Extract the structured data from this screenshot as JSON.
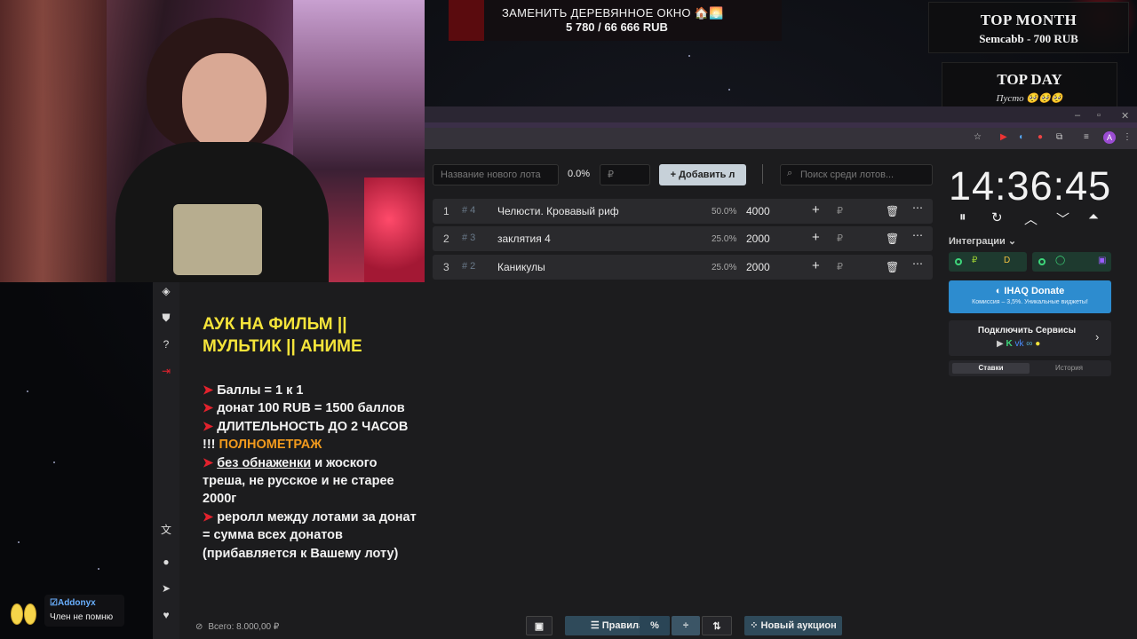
{
  "goal": {
    "title": "ЗАМЕНИТЬ ДЕРЕВЯННОЕ ОКНО 🏠🌅",
    "progress": "5 780 / 66 666 RUB"
  },
  "top_month": {
    "title": "TOP MONTH",
    "value": "Semcabb - 700 RUB"
  },
  "top_day": {
    "title": "TOP DAY",
    "value": "Пусто 🥺🥺🥺"
  },
  "browser": {
    "profile_initial": "A"
  },
  "auction": {
    "new_lot_placeholder": "Название нового лота",
    "percent": "0.0%",
    "amount_placeholder": "₽",
    "add_button": "Добавить л",
    "search_placeholder": "Поиск среди лотов...",
    "lots": [
      {
        "index": "1",
        "tag": "# 4",
        "name": "Челюсти. Кровавый риф",
        "percent": "50.0%",
        "amount": "4000",
        "currency": "₽"
      },
      {
        "index": "2",
        "tag": "# 3",
        "name": "заклятия 4",
        "percent": "25.0%",
        "amount": "2000",
        "currency": "₽"
      },
      {
        "index": "3",
        "tag": "# 2",
        "name": "Каникулы",
        "percent": "25.0%",
        "amount": "2000",
        "currency": "₽"
      }
    ]
  },
  "timer": {
    "time": "14:36:45",
    "integrations_label": "Интеграции",
    "donate_title": "IHAQ Donate",
    "donate_subtitle": "Комиссия – 3,5%. Уникальные виджеты!",
    "services_title": "Подключить Сервисы",
    "tab_bets": "Ставки",
    "tab_history": "История"
  },
  "rules": {
    "title": "АУК НА ФИЛЬМ || МУЛЬТИК || АНИМЕ",
    "line1": "Баллы = 1 к 1",
    "line2": "донат 100 RUB = 1500 баллов",
    "line3a": "ДЛИТЕЛЬНОСТЬ ДО 2 ЧАСОВ !!! ",
    "line3b": "ПОЛНОМЕТРАЖ",
    "line4a": "без обнаженки",
    "line4b": " и жоского треша, не русское и не старее 2000г",
    "line5": "реролл между лотами за донат = сумма всех донатов (прибавляется к Вашему лоту)"
  },
  "bottom": {
    "total": "Всего: 8.000,00 ₽",
    "rules_button": "Правила",
    "percent_button": "%",
    "new_auction_button": "Новый аукцион"
  },
  "chat": {
    "user": "Addonyx",
    "message": "Член не помню"
  },
  "colors": {
    "rules_title": "#f5e43a",
    "accent_red": "#e3222d",
    "accent_orange": "#f29a1d",
    "donate_blue": "#2d8ccf"
  }
}
